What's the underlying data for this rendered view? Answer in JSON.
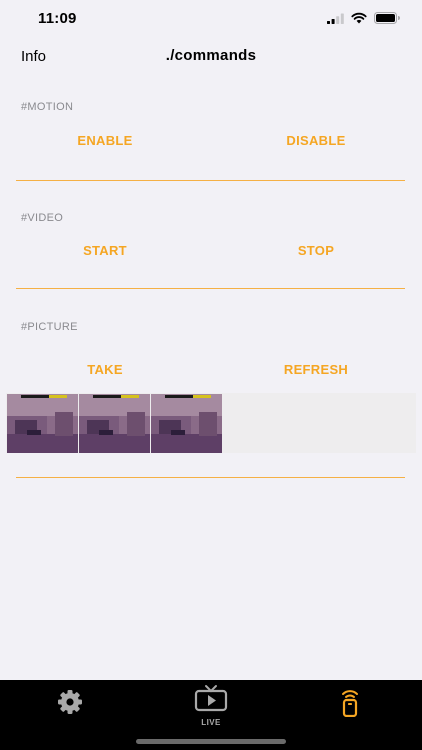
{
  "status_bar": {
    "time": "11:09"
  },
  "nav": {
    "left_label": "Info",
    "title": "./commands"
  },
  "sections": {
    "motion": {
      "header": "#MOTION",
      "left_button": "ENABLE",
      "right_button": "DISABLE"
    },
    "video": {
      "header": "#VIDEO",
      "left_button": "START",
      "right_button": "STOP"
    },
    "picture": {
      "header": "#PICTURE",
      "left_button": "TAKE",
      "right_button": "REFRESH"
    }
  },
  "thumbnails": [
    {
      "name": "picture-1"
    },
    {
      "name": "picture-2"
    },
    {
      "name": "picture-3"
    }
  ],
  "tab_bar": {
    "tabs": [
      {
        "icon": "gear-icon",
        "label": "",
        "selected": false
      },
      {
        "icon": "tv-icon",
        "label": "LIVE",
        "selected": false
      },
      {
        "icon": "remote-icon",
        "label": "",
        "selected": true
      }
    ]
  },
  "colors": {
    "accent": "#f5a623",
    "background": "#f2f1f6",
    "tab_bar": "#000000",
    "tab_inactive": "#a9a9a9"
  }
}
